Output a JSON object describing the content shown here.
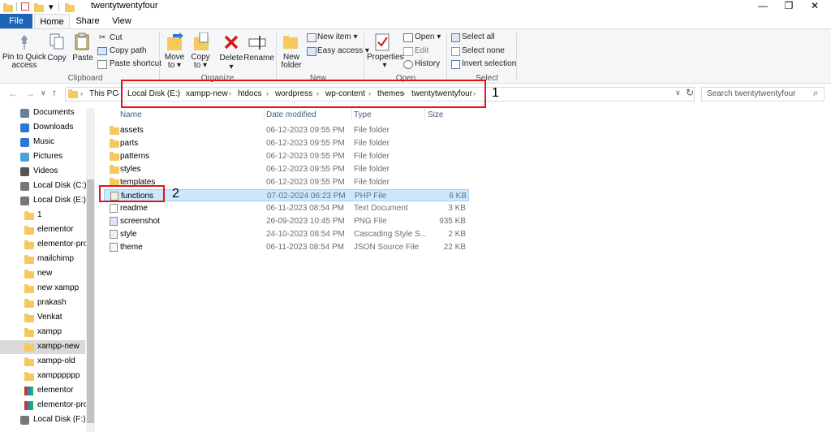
{
  "window": {
    "title": "twentytwentyfour",
    "minimize": "—",
    "maximize": "❐",
    "close": "✕",
    "qa_dropdown": "▾"
  },
  "ribbon_tabs": [
    "File",
    "Home",
    "Share",
    "View"
  ],
  "ribbon": {
    "pin": "Pin to Quick access",
    "copy": "Copy",
    "paste": "Paste",
    "cut": "Cut",
    "copy_path": "Copy path",
    "paste_shortcut": "Paste shortcut",
    "clipboard": "Clipboard",
    "move_to": "Move to ▾",
    "copy_to": "Copy to ▾",
    "delete": "Delete ▾",
    "rename": "Rename",
    "organize": "Organize",
    "new_folder": "New folder",
    "new_item": "New item ▾",
    "easy_access": "Easy access ▾",
    "new_group": "New",
    "properties": "Properties ▾",
    "open": "Open ▾",
    "edit": "Edit",
    "history": "History",
    "open_group": "Open",
    "select_all": "Select all",
    "select_none": "Select none",
    "invert_selection": "Invert selection",
    "select_group": "Select"
  },
  "nav": {
    "back": "←",
    "forward": "→",
    "recent": "∨",
    "up": "↑",
    "refresh": "↻",
    "dropdown": "∨"
  },
  "breadcrumb": [
    "This PC",
    "Local Disk (E:)",
    "xampp-new",
    "htdocs",
    "wordpress",
    "wp-content",
    "themes",
    "twentytwentyfour"
  ],
  "separator": "›",
  "annotations": {
    "one": "1",
    "two": "2"
  },
  "search": {
    "placeholder": "Search twentytwentyfour",
    "icon": "⌕"
  },
  "sidebar": [
    {
      "label": "Documents",
      "icon": "documents"
    },
    {
      "label": "Downloads",
      "icon": "downloads"
    },
    {
      "label": "Music",
      "icon": "music"
    },
    {
      "label": "Pictures",
      "icon": "pictures"
    },
    {
      "label": "Videos",
      "icon": "videos"
    },
    {
      "label": "Local Disk (C:)",
      "icon": "drive"
    },
    {
      "label": "Local Disk (E:)",
      "icon": "drive"
    },
    {
      "label": "1",
      "icon": "folder"
    },
    {
      "label": "elementor",
      "icon": "folder"
    },
    {
      "label": "elementor-pro",
      "icon": "folder"
    },
    {
      "label": "mailchimp",
      "icon": "folder"
    },
    {
      "label": "new",
      "icon": "folder"
    },
    {
      "label": "new xampp",
      "icon": "folder"
    },
    {
      "label": "prakash",
      "icon": "folder"
    },
    {
      "label": "Venkat",
      "icon": "folder"
    },
    {
      "label": "xampp",
      "icon": "folder"
    },
    {
      "label": "xampp-new",
      "icon": "folder"
    },
    {
      "label": "xampp-old",
      "icon": "folder"
    },
    {
      "label": "xampppppp",
      "icon": "folder"
    },
    {
      "label": "elementor",
      "icon": "archive"
    },
    {
      "label": "elementor-pro",
      "icon": "archive"
    },
    {
      "label": "Local Disk (F:)",
      "icon": "drive"
    }
  ],
  "columns": [
    "Name",
    "Date modified",
    "Type",
    "Size"
  ],
  "files": [
    {
      "name": "assets",
      "date": "06-12-2023 09:55 PM",
      "type": "File folder",
      "size": "",
      "icon": "folder"
    },
    {
      "name": "parts",
      "date": "06-12-2023 09:55 PM",
      "type": "File folder",
      "size": "",
      "icon": "folder"
    },
    {
      "name": "patterns",
      "date": "06-12-2023 09:55 PM",
      "type": "File folder",
      "size": "",
      "icon": "folder"
    },
    {
      "name": "styles",
      "date": "06-12-2023 09:55 PM",
      "type": "File folder",
      "size": "",
      "icon": "folder"
    },
    {
      "name": "templates",
      "date": "06-12-2023 09:55 PM",
      "type": "File folder",
      "size": "",
      "icon": "folder"
    },
    {
      "name": "functions",
      "date": "07-02-2024 06:23 PM",
      "type": "PHP File",
      "size": "6 KB",
      "icon": "php"
    },
    {
      "name": "readme",
      "date": "06-11-2023 08:54 PM",
      "type": "Text Document",
      "size": "3 KB",
      "icon": "text"
    },
    {
      "name": "screenshot",
      "date": "26-09-2023 10:45 PM",
      "type": "PNG File",
      "size": "935 KB",
      "icon": "image"
    },
    {
      "name": "style",
      "date": "24-10-2023 08:54 PM",
      "type": "Cascading Style S...",
      "size": "2 KB",
      "icon": "css"
    },
    {
      "name": "theme",
      "date": "06-11-2023 08:54 PM",
      "type": "JSON Source File",
      "size": "22 KB",
      "icon": "json"
    }
  ]
}
